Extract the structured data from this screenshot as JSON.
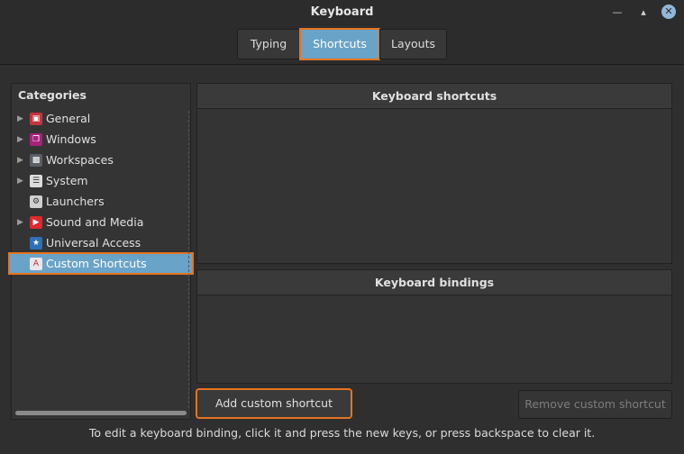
{
  "window": {
    "title": "Keyboard"
  },
  "tabs": [
    {
      "label": "Typing"
    },
    {
      "label": "Shortcuts"
    },
    {
      "label": "Layouts"
    }
  ],
  "categories": {
    "header": "Categories",
    "items": [
      {
        "label": "General",
        "icon": "general-icon",
        "expandable": true
      },
      {
        "label": "Windows",
        "icon": "windows-icon",
        "expandable": true
      },
      {
        "label": "Workspaces",
        "icon": "workspaces-icon",
        "expandable": true
      },
      {
        "label": "System",
        "icon": "system-icon",
        "expandable": true
      },
      {
        "label": "Launchers",
        "icon": "launchers-icon",
        "expandable": false
      },
      {
        "label": "Sound and Media",
        "icon": "sound-media-icon",
        "expandable": true
      },
      {
        "label": "Universal Access",
        "icon": "universal-access-icon",
        "expandable": false
      },
      {
        "label": "Custom Shortcuts",
        "icon": "custom-shortcuts-icon",
        "expandable": false,
        "selected": true
      }
    ]
  },
  "shortcuts_panel": {
    "header": "Keyboard shortcuts"
  },
  "bindings_panel": {
    "header": "Keyboard bindings"
  },
  "buttons": {
    "add": "Add custom shortcut",
    "remove": "Remove custom shortcut"
  },
  "hint": "To edit a keyboard binding, click it and press the new keys, or press backspace to clear it.",
  "colors": {
    "accent": "#6aa3c8",
    "highlight": "#e6741f",
    "background": "#2f2f2f"
  }
}
